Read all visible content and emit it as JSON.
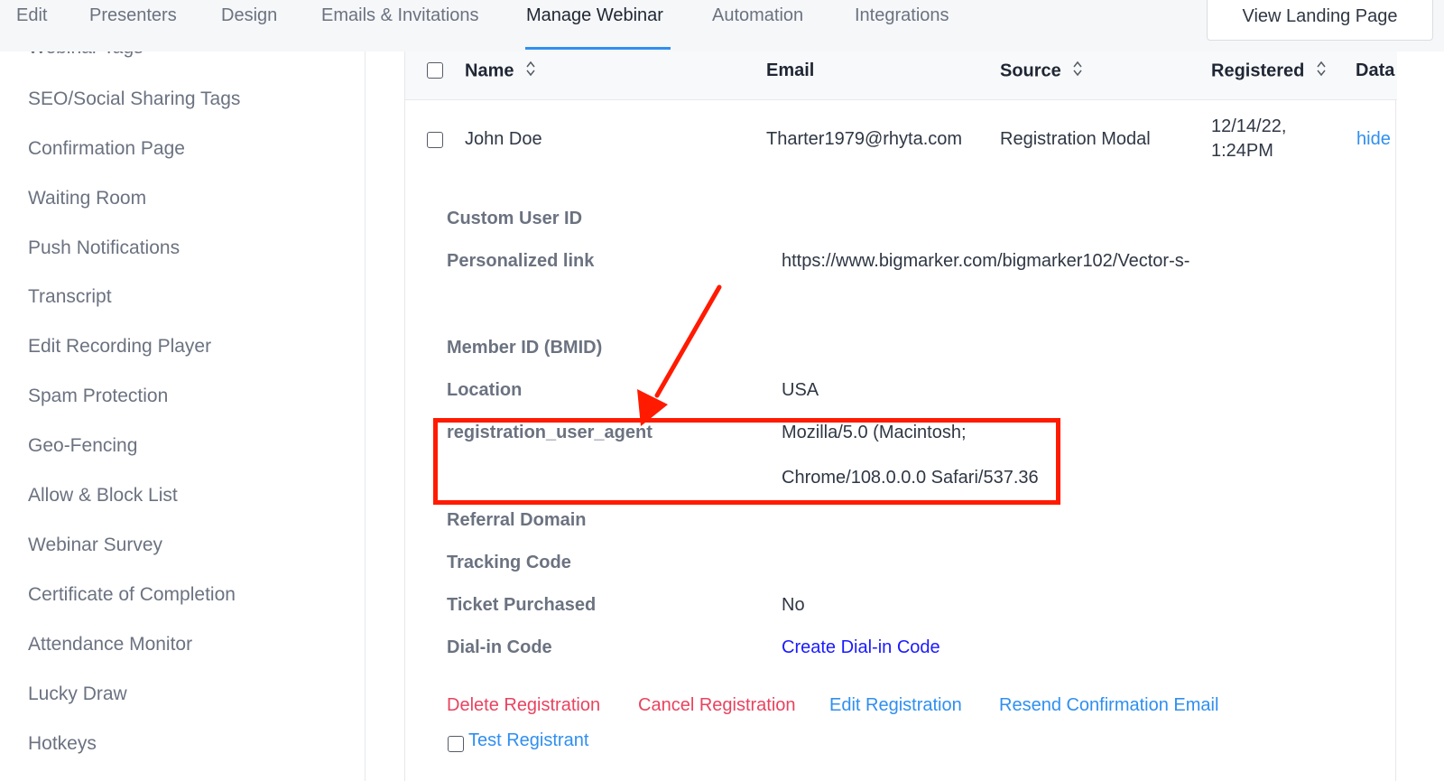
{
  "nav": {
    "tabs": [
      {
        "label": "Edit"
      },
      {
        "label": "Presenters"
      },
      {
        "label": "Design"
      },
      {
        "label": "Emails & Invitations"
      },
      {
        "label": "Manage Webinar"
      },
      {
        "label": "Automation"
      },
      {
        "label": "Integrations"
      }
    ],
    "active_tab": "Manage Webinar",
    "view_landing_page": "View Landing Page"
  },
  "sidebar": {
    "items": [
      {
        "label": "Webinar Tags"
      },
      {
        "label": "SEO/Social Sharing Tags"
      },
      {
        "label": "Confirmation Page"
      },
      {
        "label": "Waiting Room"
      },
      {
        "label": "Push Notifications"
      },
      {
        "label": "Transcript"
      },
      {
        "label": "Edit Recording Player"
      },
      {
        "label": "Spam Protection"
      },
      {
        "label": "Geo-Fencing"
      },
      {
        "label": "Allow & Block List"
      },
      {
        "label": "Webinar Survey"
      },
      {
        "label": "Certificate of Completion"
      },
      {
        "label": "Attendance Monitor"
      },
      {
        "label": "Lucky Draw"
      },
      {
        "label": "Hotkeys"
      }
    ]
  },
  "table": {
    "columns": {
      "name": "Name",
      "email": "Email",
      "source": "Source",
      "registered": "Registered",
      "data": "Data"
    },
    "row": {
      "name": "John Doe",
      "email": "Tharter1979@rhyta.com",
      "source": "Registration Modal",
      "registered_date": "12/14/22,",
      "registered_time": "1:24PM",
      "toggle": "hide"
    }
  },
  "details": {
    "custom_user_id_label": "Custom User ID",
    "personalized_link_label": "Personalized link",
    "personalized_link_value": "https://www.bigmarker.com/bigmarker102/Vector-s-",
    "member_id_label": "Member ID (BMID)",
    "location_label": "Location",
    "location_value": "USA",
    "user_agent_label": "registration_user_agent",
    "user_agent_value_line1": "Mozilla/5.0 (Macintosh;",
    "user_agent_value_line2": "Chrome/108.0.0.0 Safari/537.36",
    "referral_domain_label": "Referral Domain",
    "tracking_code_label": "Tracking Code",
    "ticket_purchased_label": "Ticket Purchased",
    "ticket_purchased_value": "No",
    "dial_in_code_label": "Dial-in Code",
    "dial_in_code_link": "Create Dial-in Code"
  },
  "actions": {
    "delete": "Delete Registration",
    "cancel": "Cancel Registration",
    "edit": "Edit Registration",
    "resend": "Resend Confirmation Email",
    "test_registrant": "Test Registrant"
  },
  "colors": {
    "active_tab_underline": "#2f8ff0",
    "danger_link": "#e8435f",
    "info_link": "#2f8ff0",
    "dial_link": "#1a1aff",
    "annotation": "#ff1a00"
  },
  "annotation": {
    "type": "red-arrow-and-box",
    "target": "registration_user_agent"
  }
}
